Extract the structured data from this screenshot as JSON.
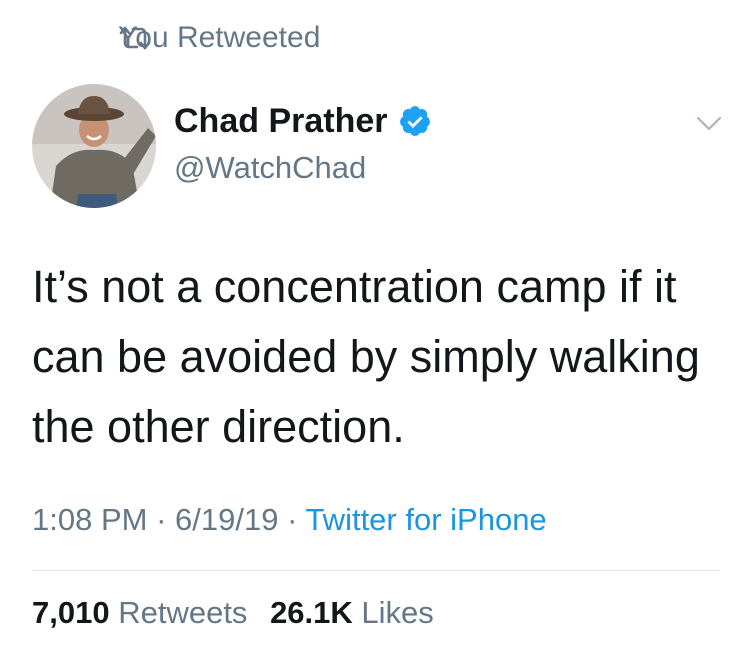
{
  "retweet_context": {
    "icon": "retweet-icon",
    "label": "You Retweeted"
  },
  "author": {
    "display_name": "Chad Prather",
    "handle": "@WatchChad",
    "verified": true,
    "verified_icon": "verified-badge-icon",
    "avatar": "avatar-photo"
  },
  "menu_icon": "chevron-down-icon",
  "tweet": {
    "text": "It’s not a concentration camp if it\ncan be avoided by simply walking\nthe other direction.",
    "time": "1:08 PM",
    "separator": " · ",
    "date": "6/19/19",
    "source": "Twitter for iPhone"
  },
  "stats": {
    "retweets_count": "7,010",
    "retweets_label": "Retweets",
    "likes_count": "26.1K",
    "likes_label": "Likes"
  },
  "colors": {
    "text_primary": "#14171a",
    "text_secondary": "#657786",
    "link": "#1b95e0",
    "verified": "#1da1f2",
    "divider": "#e1e8ed"
  }
}
